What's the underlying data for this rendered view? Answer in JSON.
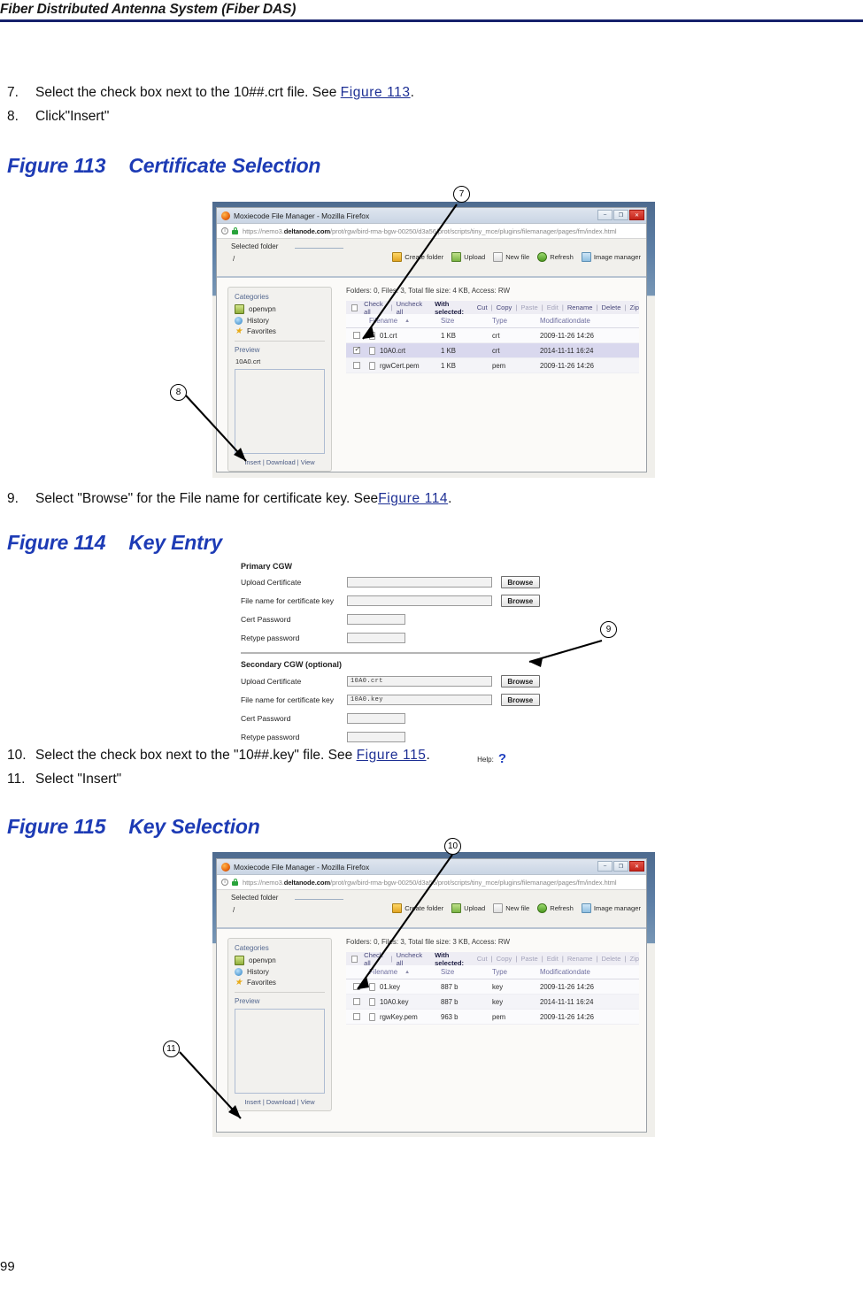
{
  "document": {
    "running_header": "Fiber Distributed Antenna System (Fiber DAS)",
    "page_number": "99"
  },
  "steps_group_1": [
    {
      "num": "7.",
      "text_before": "Select the check box next to the 10##.crt file. See ",
      "link": "Figure 113",
      "text_after": "."
    },
    {
      "num": "8.",
      "text_before": "Click\"Insert\"",
      "link": "",
      "text_after": ""
    }
  ],
  "steps_group_2": [
    {
      "num": "9.",
      "text_before": "Select \"Browse\" for the File name for certificate key. See",
      "link": "Figure 114",
      "text_after": "."
    }
  ],
  "steps_group_3": [
    {
      "num": "10.",
      "text_before": "Select the check box next to the \"10##.key\" file. See ",
      "link": "Figure 115",
      "text_after": "."
    },
    {
      "num": "11.",
      "text_before": "Select \"Insert\"",
      "link": "",
      "text_after": ""
    }
  ],
  "figure_113": {
    "title_number": "Figure 113",
    "title_text": "Certificate Selection",
    "callouts": [
      {
        "label": "7"
      },
      {
        "label": "8"
      }
    ],
    "window": {
      "title": "Moxiecode File Manager - Mozilla Firefox",
      "window_buttons": [
        "–",
        "❐",
        "✕"
      ],
      "url_prefix": "https://nemo3.",
      "url_domain": "deltanode.com",
      "url_suffix": "/prot/rgw/bird-rma-bgw-00250/d3a56/prot/scripts/tiny_mce/plugins/filemanager/pages/fm/index.html",
      "selected_folder_label": "Selected folder",
      "selected_folder_value": "/",
      "toolbar": [
        {
          "label": "Create folder",
          "icon": "folder-icon"
        },
        {
          "label": "Upload",
          "icon": "upload-icon"
        },
        {
          "label": "New file",
          "icon": "new-file-icon"
        },
        {
          "label": "Refresh",
          "icon": "refresh-icon"
        },
        {
          "label": "Image manager",
          "icon": "image-manager-icon"
        }
      ],
      "sidebar": {
        "categories_header": "Categories",
        "categories": [
          {
            "label": "openvpn",
            "icon": "openvpn-icon"
          },
          {
            "label": "History",
            "icon": "history-icon"
          },
          {
            "label": "Favorites",
            "icon": "star-icon"
          }
        ],
        "preview_header": "Preview",
        "preview_name": "10A0.crt",
        "actions": "Insert | Download | View"
      },
      "stats": "Folders: 0, Files: 3, Total file size: 4 KB, Access: RW",
      "action_bar": {
        "check_all": "Check all",
        "uncheck_all": "Uncheck all",
        "with_selected": "With selected:",
        "actions": [
          "Cut",
          "Copy",
          "Paste",
          "Edit",
          "Rename",
          "Delete",
          "Zip"
        ],
        "disabled_actions": [
          "Paste",
          "Edit"
        ]
      },
      "columns": [
        "Filename",
        "Size",
        "Type",
        "Modificationdate"
      ],
      "rows": [
        {
          "checked": false,
          "name": "01.crt",
          "size": "1 KB",
          "type": "crt",
          "date": "2009-11-26 14:26",
          "selected": false
        },
        {
          "checked": true,
          "name": "10A0.crt",
          "size": "1 KB",
          "type": "crt",
          "date": "2014-11-11 16:24",
          "selected": true
        },
        {
          "checked": false,
          "name": "rgwCert.pem",
          "size": "1 KB",
          "type": "pem",
          "date": "2009-11-26 14:26",
          "selected": false
        }
      ]
    }
  },
  "figure_114": {
    "title_number": "Figure 114",
    "title_text": "Key Entry",
    "callouts": [
      {
        "label": "9"
      }
    ],
    "form": {
      "primary_header": "Primary CGW",
      "secondary_header": "Secondary CGW (optional)",
      "browse_label": "Browse",
      "help_label": "Help:",
      "primary_rows": [
        {
          "label": "Upload Certificate",
          "value": "",
          "has_button": true,
          "field": "wide"
        },
        {
          "label": "File name for certificate key",
          "value": "",
          "has_button": true,
          "field": "wide"
        },
        {
          "label": "Cert  Password",
          "value": "",
          "has_button": false,
          "field": "narrow"
        },
        {
          "label": "Retype password",
          "value": "",
          "has_button": false,
          "field": "narrow"
        }
      ],
      "secondary_rows": [
        {
          "label": "Upload Certificate",
          "value": "10A0.crt",
          "has_button": true,
          "field": "wide"
        },
        {
          "label": "File name for certificate key",
          "value": "10A0.key",
          "has_button": true,
          "field": "wide"
        },
        {
          "label": "Cert  Password",
          "value": "",
          "has_button": false,
          "field": "narrow"
        },
        {
          "label": "Retype password",
          "value": "",
          "has_button": false,
          "field": "narrow"
        }
      ]
    }
  },
  "figure_115": {
    "title_number": "Figure 115",
    "title_text": "Key Selection",
    "callouts": [
      {
        "label": "10"
      },
      {
        "label": "11"
      }
    ],
    "window": {
      "title": "Moxiecode File Manager - Mozilla Firefox",
      "window_buttons": [
        "–",
        "❐",
        "✕"
      ],
      "url_prefix": "https://nemo3.",
      "url_domain": "deltanode.com",
      "url_suffix": "/prot/rgw/bird-rma-bgw-00250/d3a56/prot/scripts/tiny_mce/plugins/filemanager/pages/fm/index.html",
      "selected_folder_label": "Selected folder",
      "selected_folder_value": "/",
      "toolbar": [
        {
          "label": "Create folder",
          "icon": "folder-icon"
        },
        {
          "label": "Upload",
          "icon": "upload-icon"
        },
        {
          "label": "New file",
          "icon": "new-file-icon"
        },
        {
          "label": "Refresh",
          "icon": "refresh-icon"
        },
        {
          "label": "Image manager",
          "icon": "image-manager-icon"
        }
      ],
      "sidebar": {
        "categories_header": "Categories",
        "categories": [
          {
            "label": "openvpn",
            "icon": "openvpn-icon"
          },
          {
            "label": "History",
            "icon": "history-icon"
          },
          {
            "label": "Favorites",
            "icon": "star-icon"
          }
        ],
        "preview_header": "Preview",
        "preview_name": "",
        "actions": "Insert | Download | View"
      },
      "stats": "Folders: 0, Files: 3, Total file size: 3 KB, Access: RW",
      "action_bar": {
        "check_all": "Check all",
        "uncheck_all": "Uncheck all",
        "with_selected": "With selected:",
        "actions": [
          "Cut",
          "Copy",
          "Paste",
          "Edit",
          "Rename",
          "Delete",
          "Zip"
        ],
        "disabled_actions": [
          "Cut",
          "Copy",
          "Paste",
          "Edit",
          "Rename",
          "Delete",
          "Zip"
        ]
      },
      "columns": [
        "Filename",
        "Size",
        "Type",
        "Modificationdate"
      ],
      "rows": [
        {
          "checked": false,
          "name": "01.key",
          "size": "887 b",
          "type": "key",
          "date": "2009-11-26 14:26",
          "selected": false
        },
        {
          "checked": false,
          "name": "10A0.key",
          "size": "887 b",
          "type": "key",
          "date": "2014-11-11 16:24",
          "selected": false
        },
        {
          "checked": false,
          "name": "rgwKey.pem",
          "size": "963 b",
          "type": "pem",
          "date": "2009-11-26 14:26",
          "selected": false
        }
      ]
    }
  },
  "colors": {
    "heading_blue": "#1d3bb5",
    "rule_navy": "#16216b",
    "link_blue": "#1d2f94"
  }
}
